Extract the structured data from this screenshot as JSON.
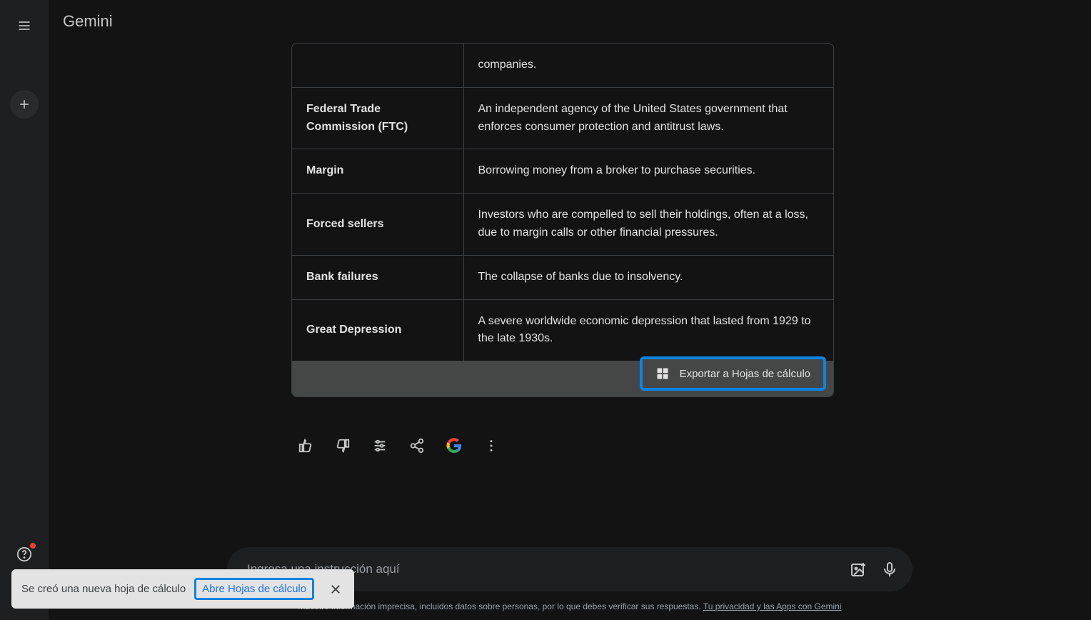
{
  "app": {
    "title": "Gemini"
  },
  "table": {
    "rows": [
      {
        "term_partial": "",
        "def_partial": "companies."
      },
      {
        "term": "Federal Trade Commission (FTC)",
        "def": "An independent agency of the United States government that enforces consumer protection and antitrust laws."
      },
      {
        "term": "Margin",
        "def": "Borrowing money from a broker to purchase securities."
      },
      {
        "term": "Forced sellers",
        "def": "Investors who are compelled to sell their holdings, often at a loss, due to margin calls or other financial pressures."
      },
      {
        "term": "Bank failures",
        "def": "The collapse of banks due to insolvency."
      },
      {
        "term": "Great Depression",
        "def": "A severe worldwide economic depression that lasted from 1929 to the late 1930s."
      }
    ],
    "export_label": "Exportar a Hojas de cálculo"
  },
  "input": {
    "placeholder": "Ingresa una instrucción aquí"
  },
  "disclaimer": {
    "prefix": "muestre información imprecisa, incluidos datos sobre personas, por lo que debes verificar sus respuestas. ",
    "link": "Tu privacidad y las Apps con Gemini"
  },
  "snackbar": {
    "message": "Se creó una nueva hoja de cálculo",
    "link": "Abre Hojas de cálculo"
  }
}
